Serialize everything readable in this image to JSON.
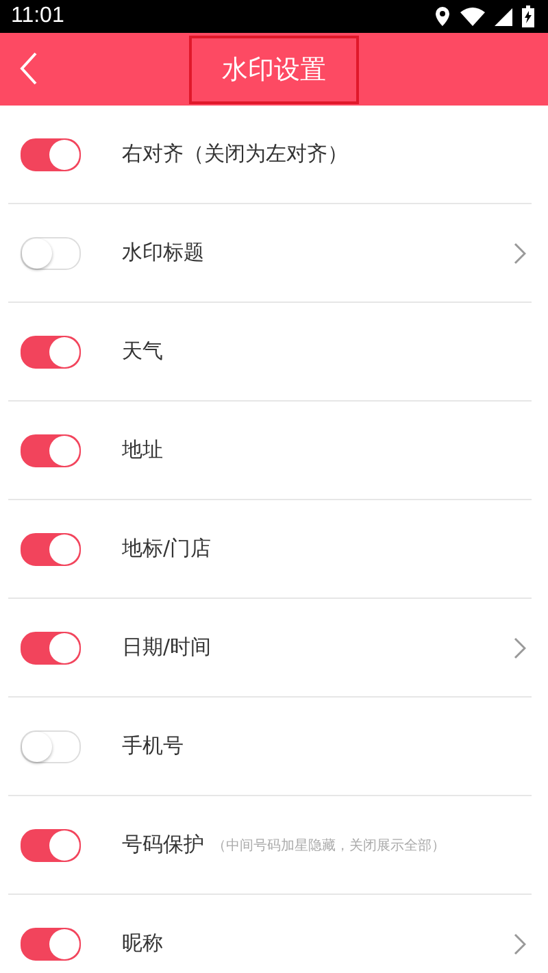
{
  "status_bar": {
    "time": "11:01"
  },
  "header": {
    "title": "水印设置",
    "title_highlighted": true
  },
  "settings": [
    {
      "label": "右对齐（关闭为左对齐）",
      "on": true,
      "has_arrow": false
    },
    {
      "label": "水印标题",
      "on": false,
      "has_arrow": true
    },
    {
      "label": "天气",
      "on": true,
      "has_arrow": false
    },
    {
      "label": "地址",
      "on": true,
      "has_arrow": false
    },
    {
      "label": "地标/门店",
      "on": true,
      "has_arrow": false
    },
    {
      "label": "日期/时间",
      "on": true,
      "has_arrow": true
    },
    {
      "label": "手机号",
      "on": false,
      "has_arrow": false
    },
    {
      "label": "号码保护",
      "hint": "（中间号码加星隐藏，关闭展示全部）",
      "on": true,
      "has_arrow": false
    },
    {
      "label": "昵称",
      "on": true,
      "has_arrow": true
    }
  ]
}
